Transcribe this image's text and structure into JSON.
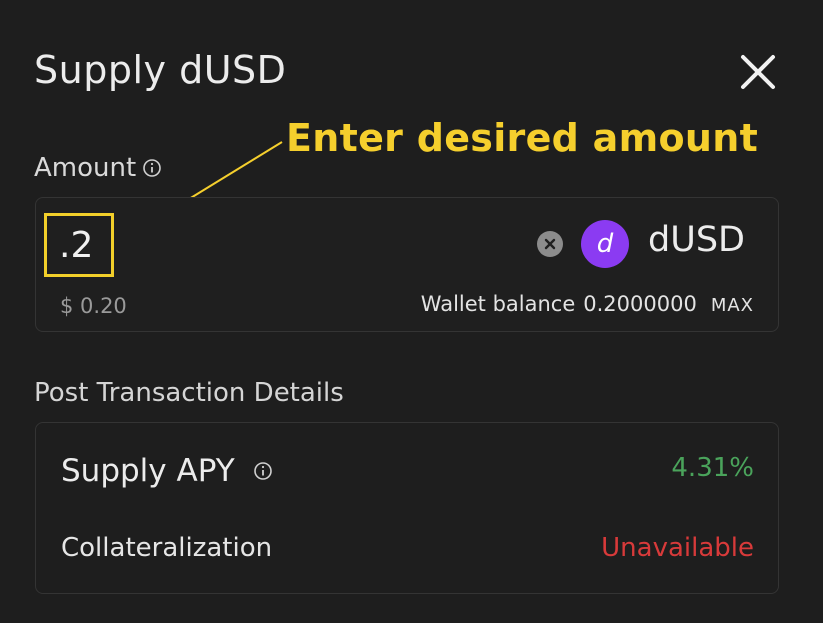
{
  "modal": {
    "title": "Supply dUSD",
    "close_icon": "close-icon"
  },
  "annotation": {
    "text": "Enter desired amount"
  },
  "amount": {
    "label": "Amount",
    "input_value": ".2",
    "usd_value": "$ 0.20",
    "token_symbol": "dUSD",
    "token_icon_glyph": "d",
    "token_color": "#8b3bf2",
    "wallet_balance_label": "Wallet balance",
    "wallet_balance_value": "0.2000000",
    "max_label": "MAX"
  },
  "details": {
    "section_title": "Post Transaction Details",
    "supply_apy_label": "Supply APY",
    "supply_apy_value": "4.31%",
    "supply_apy_color": "#4aa35b",
    "collateralization_label": "Collateralization",
    "collateralization_value": "Unavailable",
    "collateralization_color": "#d83a3a"
  },
  "colors": {
    "background": "#1e1e1e",
    "annotation": "#f5cf2d",
    "border": "#343434"
  }
}
